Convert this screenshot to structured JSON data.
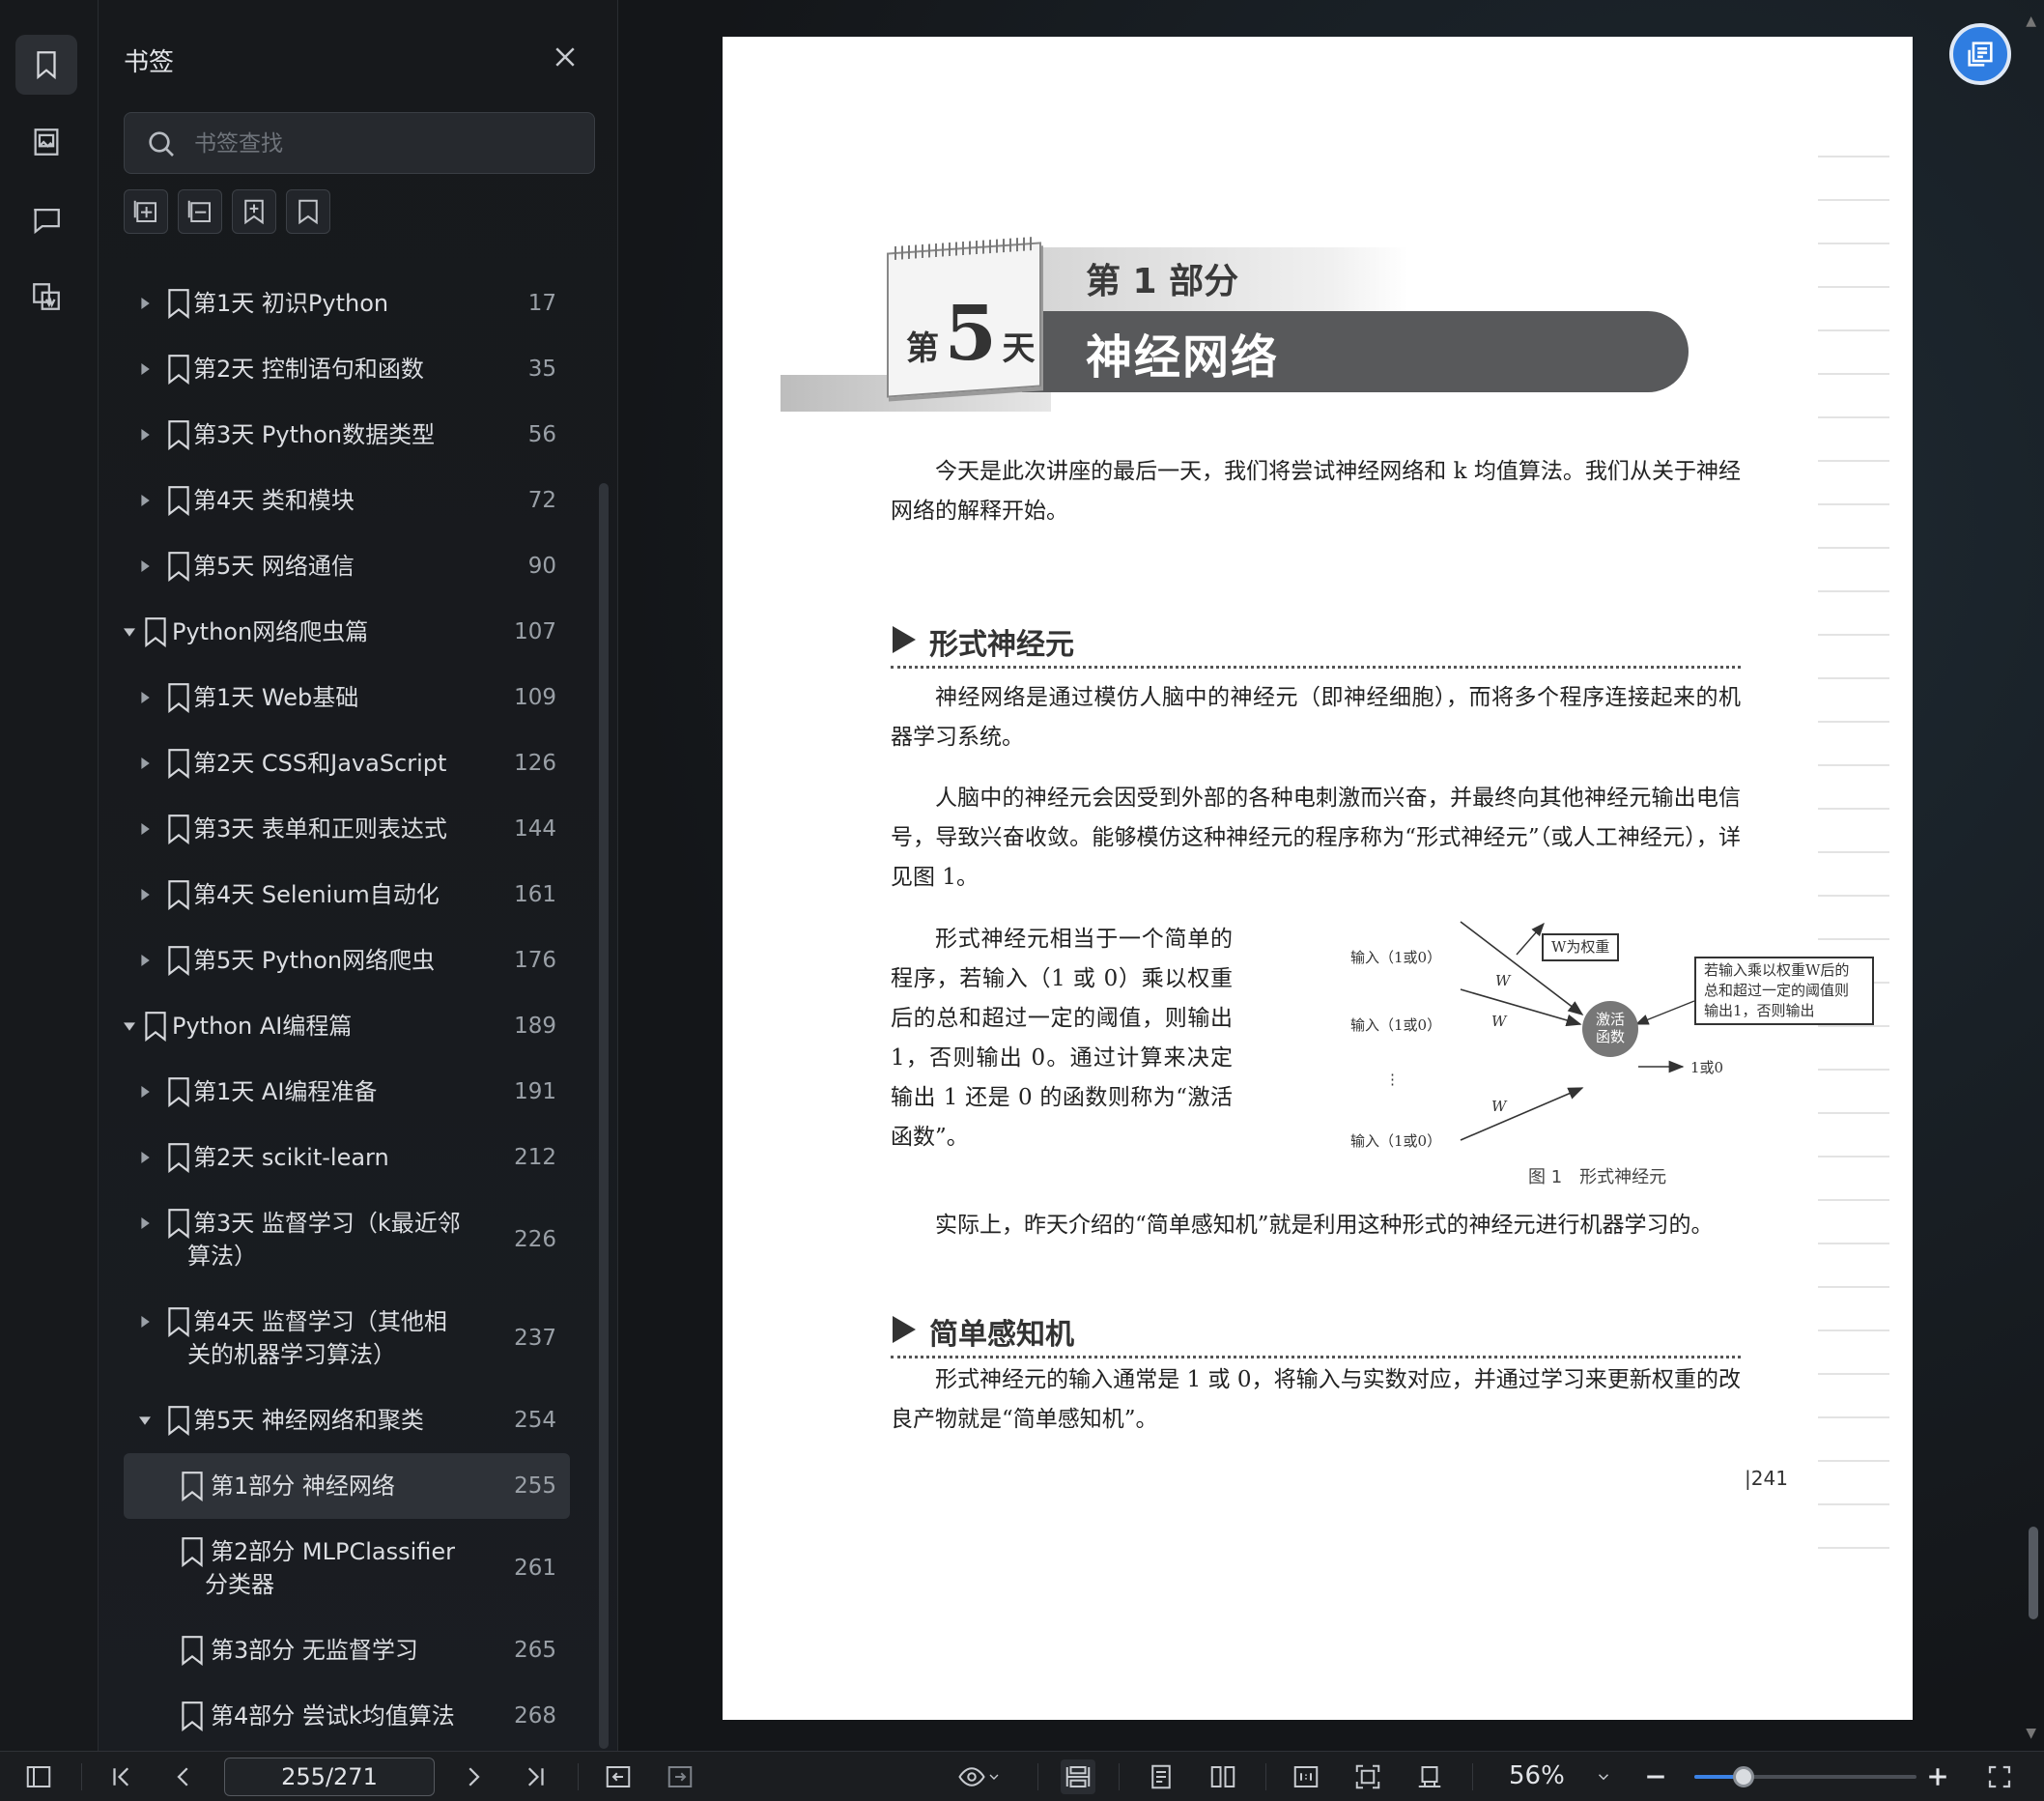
{
  "panel": {
    "title": "书签",
    "search_placeholder": "书签查找"
  },
  "bookmarks": [
    {
      "label": "第1天 初识Python",
      "page": "17",
      "level": 1,
      "arrow": "right"
    },
    {
      "label": "第2天 控制语句和函数",
      "page": "35",
      "level": 1,
      "arrow": "right"
    },
    {
      "label": "第3天 Python数据类型",
      "page": "56",
      "level": 1,
      "arrow": "right"
    },
    {
      "label": "第4天 类和模块",
      "page": "72",
      "level": 1,
      "arrow": "right"
    },
    {
      "label": "第5天 网络通信",
      "page": "90",
      "level": 1,
      "arrow": "right"
    },
    {
      "label": "Python网络爬虫篇",
      "page": "107",
      "level": 0,
      "arrow": "down"
    },
    {
      "label": "第1天 Web基础",
      "page": "109",
      "level": 1,
      "arrow": "right"
    },
    {
      "label": "第2天 CSS和JavaScript",
      "page": "126",
      "level": 1,
      "arrow": "right"
    },
    {
      "label": "第3天 表单和正则表达式",
      "page": "144",
      "level": 1,
      "arrow": "right"
    },
    {
      "label": "第4天 Selenium自动化",
      "page": "161",
      "level": 1,
      "arrow": "right"
    },
    {
      "label": "第5天 Python网络爬虫",
      "page": "176",
      "level": 1,
      "arrow": "right"
    },
    {
      "label": "Python AI编程篇",
      "page": "189",
      "level": 0,
      "arrow": "down"
    },
    {
      "label": "第1天 AI编程准备",
      "page": "191",
      "level": 1,
      "arrow": "right"
    },
    {
      "label": "第2天 scikit-learn",
      "page": "212",
      "level": 1,
      "arrow": "right"
    },
    {
      "label": "第3天 监督学习（k最近邻",
      "label2": "算法）",
      "page": "226",
      "level": 1,
      "arrow": "right"
    },
    {
      "label": "第4天 监督学习（其他相",
      "label2": "关的机器学习算法）",
      "page": "237",
      "level": 1,
      "arrow": "right"
    },
    {
      "label": "第5天 神经网络和聚类",
      "page": "254",
      "level": 1,
      "arrow": "down"
    },
    {
      "label": "第1部分 神经网络",
      "page": "255",
      "level": 2,
      "arrow": "none",
      "selected": true
    },
    {
      "label": "第2部分 MLPClassifier",
      "label2": "分类器",
      "page": "261",
      "level": 2,
      "arrow": "none"
    },
    {
      "label": "第3部分 无监督学习",
      "page": "265",
      "level": 2,
      "arrow": "none"
    },
    {
      "label": "第4部分 尝试k均值算法",
      "page": "268",
      "level": 2,
      "arrow": "none"
    }
  ],
  "document": {
    "calendar_pre": "第",
    "calendar_num": "5",
    "calendar_post": "天",
    "part_label": "第 1 部分",
    "chapter_title": "神经网络",
    "intro": "今天是此次讲座的最后一天，我们将尝试神经网络和 k 均值算法。我们从关于神经网络的解释开始。",
    "section1_title": "形式神经元",
    "p1": "神经网络是通过模仿人脑中的神经元（即神经细胞），而将多个程序连接起来的机器学习系统。",
    "p2": "人脑中的神经元会因受到外部的各种电刺激而兴奋，并最终向其他神经元输出电信号，导致兴奋收敛。能够模仿这种神经元的程序称为“形式神经元”（或人工神经元），详见图 1。",
    "p3": "形式神经元相当于一个简单的程序，若输入（1 或 0）乘以权重后的总和超过一定的阈值，则输出 1，否则输出 0。通过计算来决定输出 1 还是 0 的函数则称为“激活函数”。",
    "p4": "实际上，昨天介绍的“简单感知机”就是利用这种形式的神经元进行机器学习的。",
    "section2_title": "简单感知机",
    "p5": "形式神经元的输入通常是 1 或 0，将输入与实数对应，并通过学习来更新权重的改良产物就是“简单感知机”。",
    "page_number": "|241",
    "figure": {
      "input_label": "输入（1或0）",
      "weight_box": "W为权重",
      "w": "W",
      "dots": "⋮",
      "node_label_1": "激活",
      "node_label_2": "函数",
      "note_line1": "若输入乘以权重W后的",
      "note_line2": "总和超过一定的阈值则",
      "note_line3": "输出1，否则输出",
      "output": "1或0",
      "caption": "图 1　形式神经元"
    }
  },
  "toolbar": {
    "page_indicator": "255/271",
    "zoom": "56%",
    "zoom_fraction": 0.22
  },
  "colors": {
    "accent": "#3b82e6",
    "fab": "#2f7de1"
  }
}
